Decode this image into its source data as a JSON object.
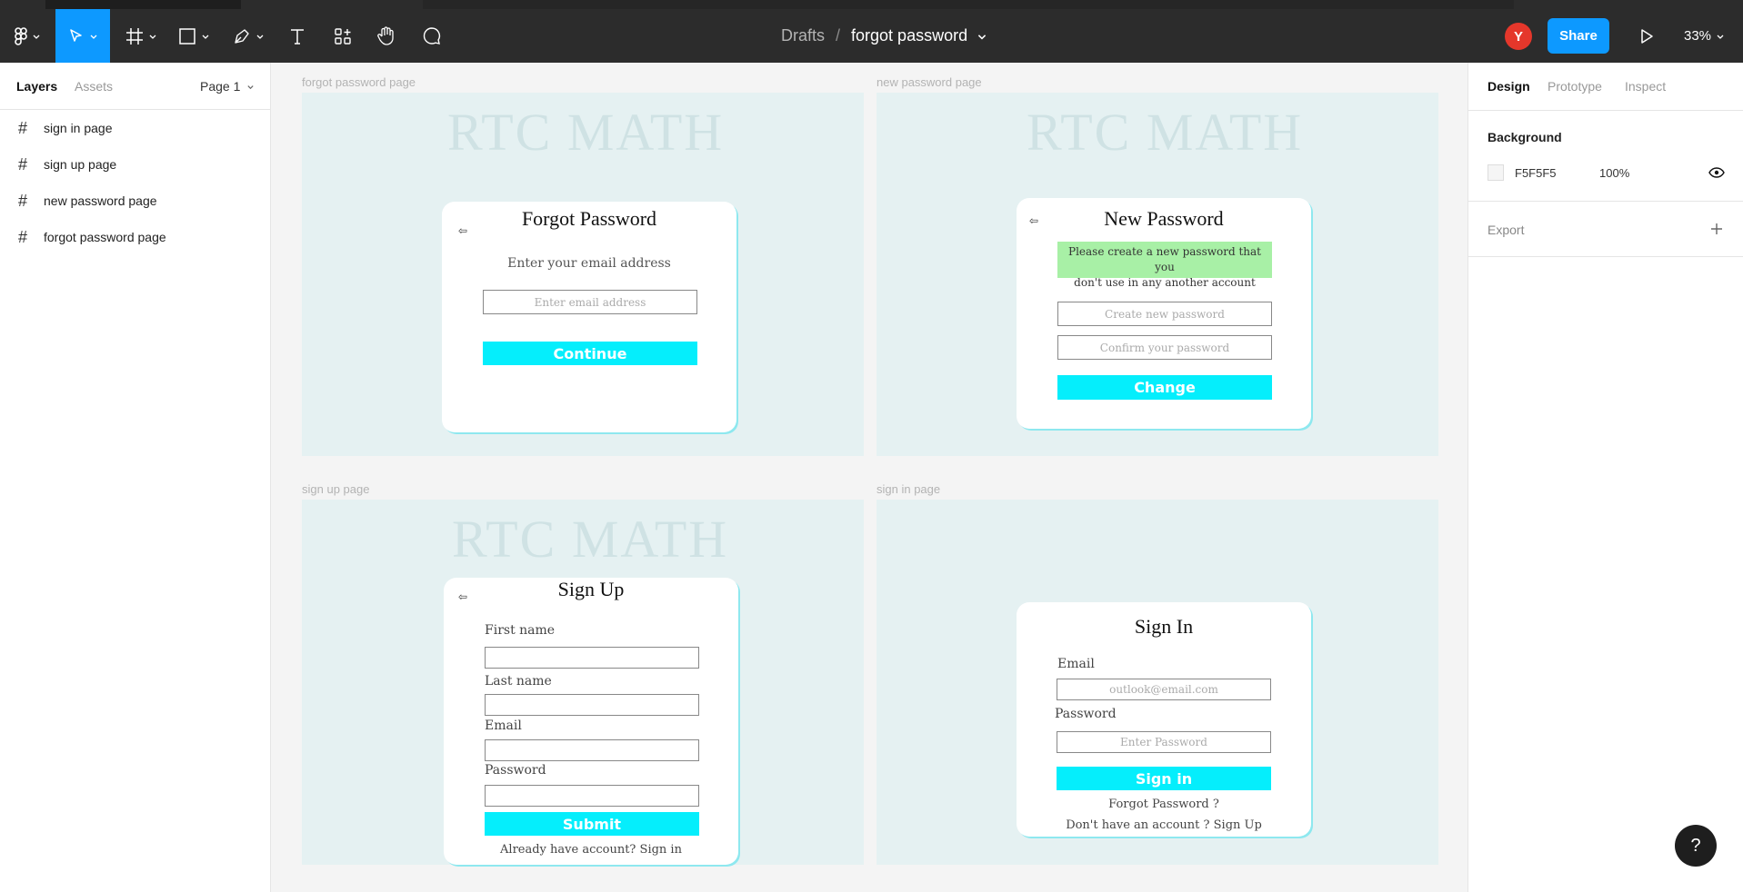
{
  "toolbar": {
    "breadcrumb_root": "Drafts",
    "breadcrumb_sep": "/",
    "file_name": "forgot password",
    "avatar_letter": "Y",
    "share_label": "Share",
    "zoom": "33%",
    "accent": "#0d99ff"
  },
  "left_panel": {
    "tabs": [
      "Layers",
      "Assets"
    ],
    "page_selector": "Page 1",
    "layers": [
      "sign in page",
      "sign up page",
      "new password page",
      "forgot password page"
    ]
  },
  "canvas": {
    "frames": {
      "forgot": {
        "label": "forgot password page",
        "brand": "RTC MATH",
        "title": "Forgot Password",
        "back_symbol": "⇦",
        "prompt": "Enter your email address",
        "email_placeholder": "Enter email address",
        "button": "Continue"
      },
      "new_password": {
        "label": "new password page",
        "brand": "RTC MATH",
        "title": "New Password",
        "back_symbol": "⇦",
        "notice_line1": "Please create a new password that you",
        "notice_line2": "don't use in any another account",
        "new_placeholder": "Create new password",
        "confirm_placeholder": "Confirm your password",
        "button": "Change"
      },
      "signup": {
        "label": "sign up page",
        "brand": "RTC MATH",
        "title": "Sign Up",
        "back_symbol": "⇦",
        "first_name": "First name",
        "last_name": "Last name",
        "email": "Email",
        "password": "Password",
        "button": "Submit",
        "footer": "Already have account? Sign in"
      },
      "signin": {
        "label": "sign in page",
        "title": "Sign In",
        "email_label": "Email",
        "email_placeholder": "outlook@email.com",
        "password_label": "Password",
        "password_placeholder": "Enter Password",
        "button": "Sign in",
        "forgot": "Forgot Password ?",
        "signup": "Don't have an account ? Sign Up"
      }
    },
    "brand_color": "#05eefc"
  },
  "right_panel": {
    "tabs": [
      "Design",
      "Prototype",
      "Inspect"
    ],
    "background_heading": "Background",
    "bg_hex": "F5F5F5",
    "bg_opacity": "100%",
    "export_heading": "Export"
  },
  "help_label": "?"
}
